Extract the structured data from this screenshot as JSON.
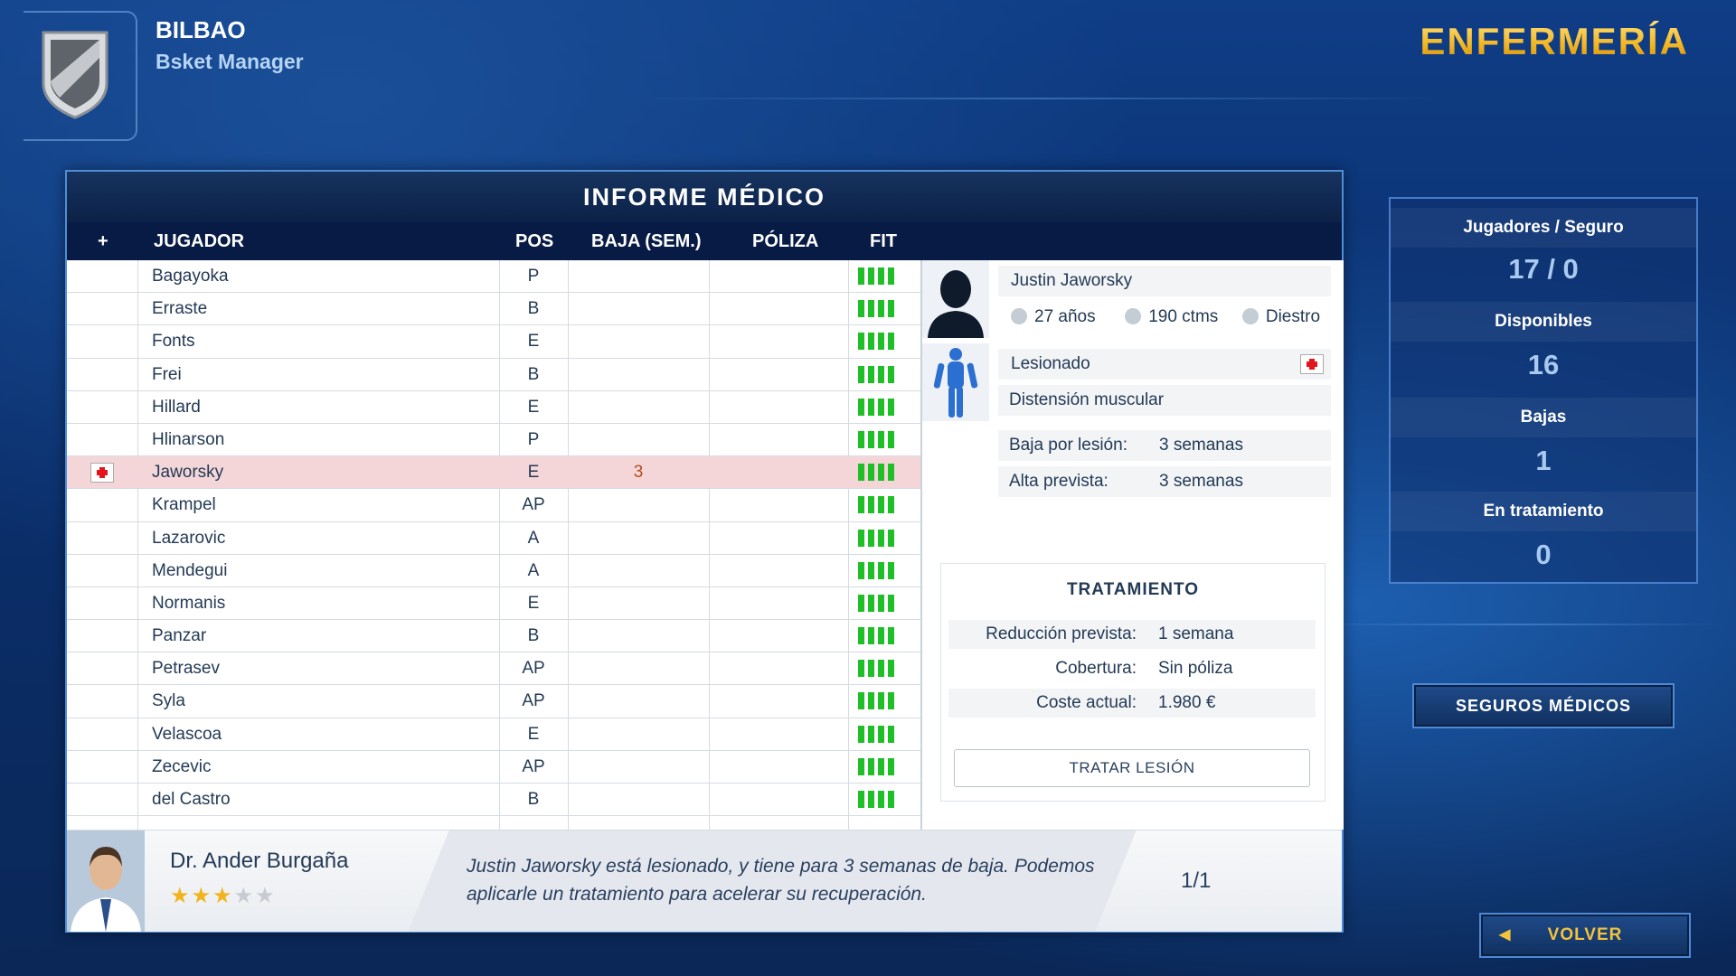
{
  "header": {
    "team_name": "BILBAO",
    "subtitle": "Bsket Manager",
    "screen_title": "ENFERMERÍA"
  },
  "panel": {
    "title": "INFORME MÉDICO",
    "columns": {
      "plus": "+",
      "player": "JUGADOR",
      "pos": "POS",
      "baja": "BAJA (SEM.)",
      "poliza": "PÓLIZA",
      "fit": "FIT"
    },
    "rows": [
      {
        "name": "Bagayoka",
        "pos": "P",
        "baja": "",
        "poliza": "",
        "injured": false,
        "fit": 4
      },
      {
        "name": "Erraste",
        "pos": "B",
        "baja": "",
        "poliza": "",
        "injured": false,
        "fit": 4
      },
      {
        "name": "Fonts",
        "pos": "E",
        "baja": "",
        "poliza": "",
        "injured": false,
        "fit": 4
      },
      {
        "name": "Frei",
        "pos": "B",
        "baja": "",
        "poliza": "",
        "injured": false,
        "fit": 4
      },
      {
        "name": "Hillard",
        "pos": "E",
        "baja": "",
        "poliza": "",
        "injured": false,
        "fit": 4
      },
      {
        "name": "Hlinarson",
        "pos": "P",
        "baja": "",
        "poliza": "",
        "injured": false,
        "fit": 4
      },
      {
        "name": "Jaworsky",
        "pos": "E",
        "baja": "3",
        "poliza": "",
        "injured": true,
        "fit": 4
      },
      {
        "name": "Krampel",
        "pos": "AP",
        "baja": "",
        "poliza": "",
        "injured": false,
        "fit": 4
      },
      {
        "name": "Lazarovic",
        "pos": "A",
        "baja": "",
        "poliza": "",
        "injured": false,
        "fit": 4
      },
      {
        "name": "Mendegui",
        "pos": "A",
        "baja": "",
        "poliza": "",
        "injured": false,
        "fit": 4
      },
      {
        "name": "Normanis",
        "pos": "E",
        "baja": "",
        "poliza": "",
        "injured": false,
        "fit": 4
      },
      {
        "name": "Panzar",
        "pos": "B",
        "baja": "",
        "poliza": "",
        "injured": false,
        "fit": 4
      },
      {
        "name": "Petrasev",
        "pos": "AP",
        "baja": "",
        "poliza": "",
        "injured": false,
        "fit": 4
      },
      {
        "name": "Syla",
        "pos": "AP",
        "baja": "",
        "poliza": "",
        "injured": false,
        "fit": 4
      },
      {
        "name": "Velascoa",
        "pos": "E",
        "baja": "",
        "poliza": "",
        "injured": false,
        "fit": 4
      },
      {
        "name": "Zecevic",
        "pos": "AP",
        "baja": "",
        "poliza": "",
        "injured": false,
        "fit": 4
      },
      {
        "name": "del Castro",
        "pos": "B",
        "baja": "",
        "poliza": "",
        "injured": false,
        "fit": 4
      }
    ],
    "selected_index": 6
  },
  "details": {
    "player_name": "Justin Jaworsky",
    "age": "27 años",
    "height": "190 ctms",
    "hand": "Diestro",
    "status": "Lesionado",
    "injury": "Distensión muscular",
    "baja_label": "Baja por lesión:",
    "baja_value": "3 semanas",
    "alta_label": "Alta prevista:",
    "alta_value": "3 semanas",
    "treatment": {
      "title": "TRATAMIENTO",
      "reduccion_label": "Reducción prevista:",
      "reduccion_value": "1 semana",
      "cobertura_label": "Cobertura:",
      "cobertura_value": "Sin póliza",
      "coste_label": "Coste actual:",
      "coste_value": "1.980 €",
      "button": "TRATAR LESIÓN"
    }
  },
  "footer": {
    "doctor_name": "Dr. Ander Burgaña",
    "doctor_rating": 3,
    "doctor_rating_max": 5,
    "message": "Justin Jaworsky está lesionado, y tiene para 3 semanas de baja. Podemos aplicarle un tratamiento para acelerar su recuperación.",
    "page": "1/1"
  },
  "stats": {
    "players_label": "Jugadores / Seguro",
    "players_value": "17 / 0",
    "available_label": "Disponibles",
    "available_value": "16",
    "injured_label": "Bajas",
    "injured_value": "1",
    "treatment_label": "En tratamiento",
    "treatment_value": "0"
  },
  "buttons": {
    "seguros": "SEGUROS MÉDICOS",
    "volver": "VOLVER"
  },
  "colors": {
    "fit_green": "#1fbf27",
    "title_gold": "#f0c240",
    "selected_row": "#f4d6d8",
    "cross_red": "#e3141b"
  }
}
